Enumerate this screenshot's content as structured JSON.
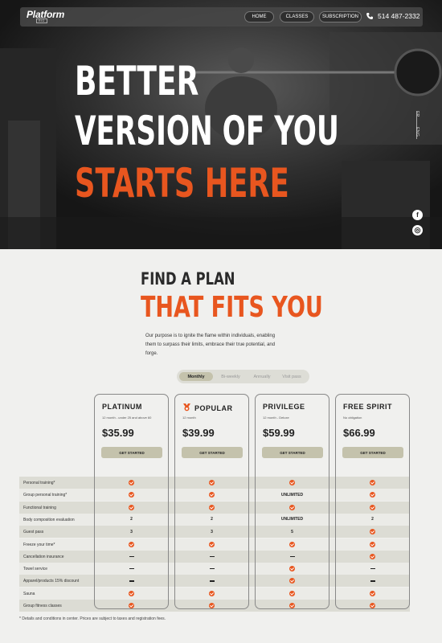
{
  "brand": {
    "logo": "Platform",
    "logo_sub": "RIO"
  },
  "nav": {
    "home": "HOME",
    "classes": "CLASSES",
    "subscription": "SUBSCRIPTION",
    "phone": "514 487-2332",
    "phone_icon": "phone-icon"
  },
  "hero": {
    "line1": "BETTER",
    "line2": "VERSION OF YOU",
    "line3": "STARTS HERE"
  },
  "lang": {
    "fr": "FR",
    "eng": "ENG"
  },
  "social": {
    "facebook": "f",
    "instagram": "◎"
  },
  "plans_section": {
    "title1": "FIND A PLAN",
    "title2": "THAT FITS YOU",
    "purpose": "Our purpose is to ignite the flame within individuals, enabling them to surpass their limits, embrace their true potential, and forge."
  },
  "billing_toggle": {
    "monthly": "Monthly",
    "biweekly": "Bi-weekly",
    "annually": "Annually",
    "visit": "Visit pass"
  },
  "plans": [
    {
      "name": "PLATINUM",
      "sub": "12 month - under 25 and above 60",
      "price": "$35.99",
      "cta": "GET STARTED"
    },
    {
      "name": "POPULAR",
      "sub": "12 month",
      "price": "$39.99",
      "cta": "GET STARTED"
    },
    {
      "name": "PRIVILEGE",
      "sub": "12 month - Deluxe",
      "price": "$59.99",
      "cta": "GET STARTED"
    },
    {
      "name": "FREE SPIRIT",
      "sub": "No obligation",
      "price": "$66.99",
      "cta": "GET STARTED"
    }
  ],
  "features": [
    {
      "label": "Personal training*",
      "values": [
        "check",
        "check",
        "check",
        "check"
      ]
    },
    {
      "label": "Group personal training*",
      "values": [
        "check",
        "check",
        "UNLIMITED",
        "check"
      ]
    },
    {
      "label": "Functional training",
      "values": [
        "check",
        "check",
        "check",
        "check"
      ]
    },
    {
      "label": "Body composition evaluation",
      "values": [
        "2",
        "2",
        "UNLIMITED",
        "2"
      ]
    },
    {
      "label": "Guest pass",
      "values": [
        "3",
        "3",
        "5",
        "check"
      ]
    },
    {
      "label": "Freeze your time*",
      "values": [
        "check",
        "check",
        "check",
        "check"
      ]
    },
    {
      "label": "Cancellation insurance",
      "values": [
        "dash",
        "dash",
        "dash",
        "check"
      ]
    },
    {
      "label": "Towel service",
      "values": [
        "dash",
        "dash",
        "check",
        "dash"
      ]
    },
    {
      "label": "Apparel/products 15% discount",
      "values": [
        "dash",
        "dash",
        "check",
        "dash"
      ]
    },
    {
      "label": "Sauna",
      "values": [
        "check",
        "check",
        "check",
        "check"
      ]
    },
    {
      "label": "Group fitness classes",
      "values": [
        "check",
        "check",
        "check",
        "check"
      ]
    }
  ],
  "footnote": "* Details and conditions in center. Prices are subject to taxes and registration fees.",
  "colors": {
    "accent": "#e8561f",
    "dark": "#1e1e1e",
    "button": "#c4c2ac"
  }
}
